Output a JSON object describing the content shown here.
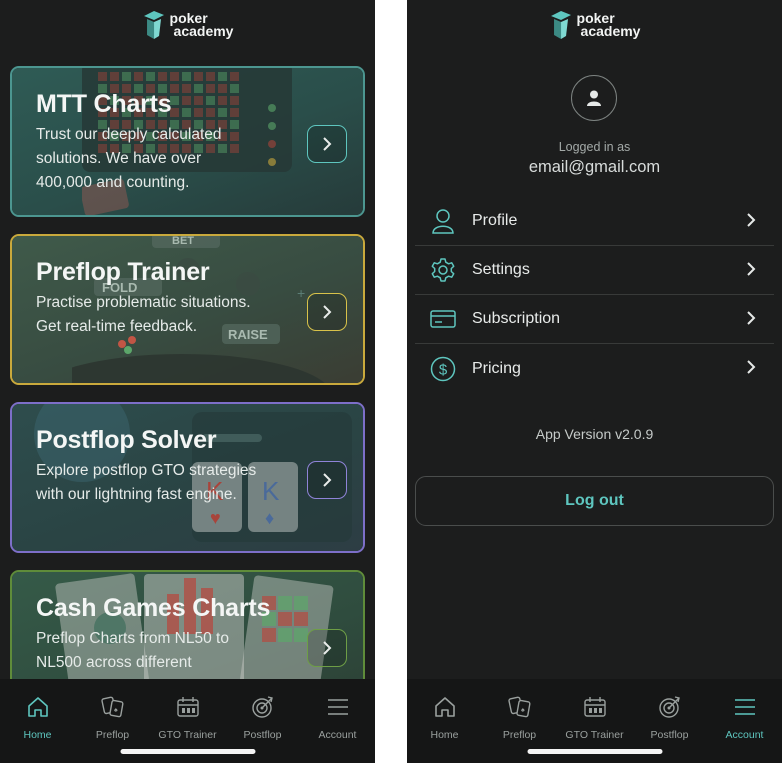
{
  "brand": {
    "line1": "poker",
    "line2": "academy",
    "accent": "#5ec6bf"
  },
  "home": {
    "cards": [
      {
        "title": "MTT Charts",
        "description": "Trust our deeply calculated solutions. We have over 400,000 and counting.",
        "border_color": "#4c9690"
      },
      {
        "title": "Preflop Trainer",
        "description": "Practise problematic situations. Get real-time feedback.",
        "border_color": "#c9a93c",
        "decor_labels": [
          "BET",
          "FOLD",
          "RAISE"
        ]
      },
      {
        "title": "Postflop Solver",
        "description": "Explore postflop GTO strategies with our lightning fast engine.",
        "border_color": "#7d6fc9",
        "decor_labels": [
          "K",
          "K"
        ]
      },
      {
        "title": "Cash Games Charts",
        "description": "Preflop Charts from NL50 to NL500 across different",
        "border_color": "#5f8c3a"
      }
    ]
  },
  "tabbar": {
    "tabs": [
      {
        "label": "Home",
        "icon": "home-icon"
      },
      {
        "label": "Preflop",
        "icon": "cards-icon"
      },
      {
        "label": "GTO Trainer",
        "icon": "calendar-icon"
      },
      {
        "label": "Postflop",
        "icon": "target-icon"
      },
      {
        "label": "Account",
        "icon": "menu-icon"
      }
    ],
    "left_active": "Home",
    "right_active": "Account"
  },
  "account": {
    "logged_in_label": "Logged in as",
    "email": "email@gmail.com",
    "menu": [
      {
        "label": "Profile",
        "icon": "user-icon"
      },
      {
        "label": "Settings",
        "icon": "gear-icon"
      },
      {
        "label": "Subscription",
        "icon": "credit-card-icon"
      },
      {
        "label": "Pricing",
        "icon": "dollar-icon"
      }
    ],
    "version": "App Version v2.0.9",
    "logout_label": "Log out"
  }
}
